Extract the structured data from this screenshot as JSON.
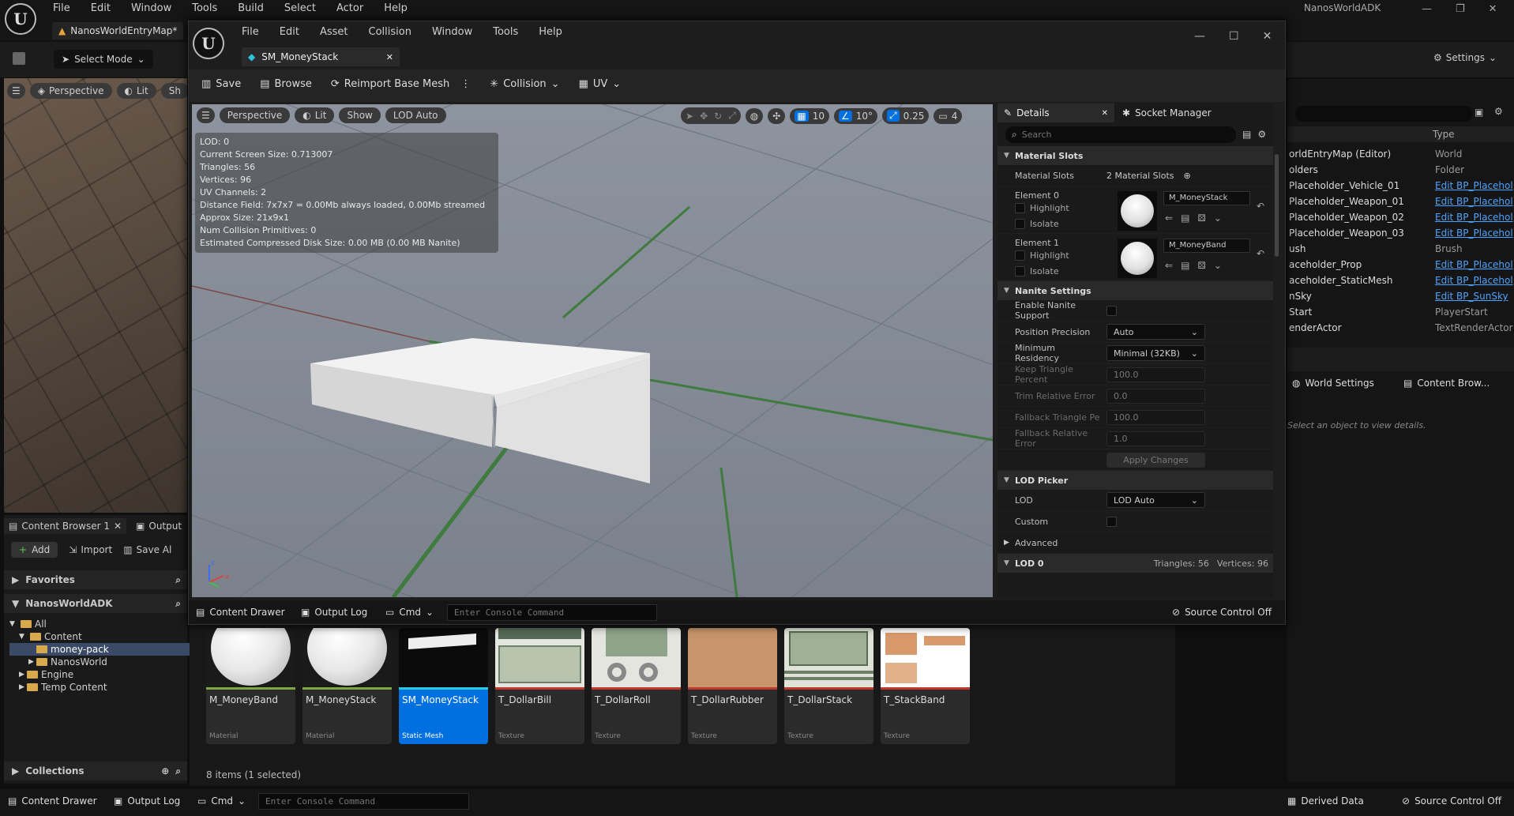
{
  "main_window": {
    "menu": [
      "File",
      "Edit",
      "Window",
      "Tools",
      "Build",
      "Select",
      "Actor",
      "Help"
    ],
    "project_name": "NanosWorldADK",
    "level_tab": "NanosWorldEntryMap*",
    "select_mode": "Select Mode",
    "settings": "Settings",
    "viewport": {
      "perspective": "Perspective",
      "lit": "Lit",
      "show": "Sh"
    },
    "outliner": {
      "type_header": "Type",
      "rows": [
        {
          "name": "orldEntryMap (Editor)",
          "type": "World",
          "link": false
        },
        {
          "name": "olders",
          "type": "Folder",
          "link": false
        },
        {
          "name": "Placeholder_Vehicle_01",
          "type": "Edit BP_Placehol",
          "link": true
        },
        {
          "name": "Placeholder_Weapon_01",
          "type": "Edit BP_Placehol",
          "link": true
        },
        {
          "name": "Placeholder_Weapon_02",
          "type": "Edit BP_Placehol",
          "link": true
        },
        {
          "name": "Placeholder_Weapon_03",
          "type": "Edit BP_Placehol",
          "link": true
        },
        {
          "name": "ush",
          "type": "Brush",
          "link": false
        },
        {
          "name": "aceholder_Prop",
          "type": "Edit BP_Placehol",
          "link": true
        },
        {
          "name": "aceholder_StaticMesh",
          "type": "Edit BP_Placehol",
          "link": true
        },
        {
          "name": "nSky",
          "type": "Edit BP_SunSky",
          "link": true
        },
        {
          "name": "Start",
          "type": "PlayerStart",
          "link": false
        },
        {
          "name": "enderActor",
          "type": "TextRenderActor",
          "link": false
        }
      ]
    },
    "world_settings_tab": "World Settings",
    "content_browser_tab": "Content Brow...",
    "select_hint": "Select an object to view details.",
    "content_browser": {
      "tab": "Content Browser 1",
      "output_tab": "Output",
      "add": "Add",
      "import": "Import",
      "save_all": "Save Al",
      "favorites": "Favorites",
      "project": "NanosWorldADK",
      "tree": [
        "All",
        "Content",
        "money-pack",
        "NanosWorld",
        "Engine",
        "Temp Content"
      ],
      "collections": "Collections",
      "status": "8 items (1 selected)"
    },
    "bottom_bar": {
      "content_drawer": "Content Drawer",
      "output_log": "Output Log",
      "cmd": "Cmd",
      "console_placeholder": "Enter Console Command",
      "derived_data": "Derived Data",
      "source_control": "Source Control Off"
    }
  },
  "mesh_editor": {
    "menu": [
      "File",
      "Edit",
      "Asset",
      "Collision",
      "Window",
      "Tools",
      "Help"
    ],
    "tab": "SM_MoneyStack",
    "toolbar": {
      "save": "Save",
      "browse": "Browse",
      "reimport": "Reimport Base Mesh",
      "collision": "Collision",
      "uv": "UV"
    },
    "viewport": {
      "perspective": "Perspective",
      "lit": "Lit",
      "show": "Show",
      "lod": "LOD Auto",
      "grid": "10",
      "angle": "10°",
      "scale": "0.25",
      "camera": "4",
      "stats": [
        "LOD:  0",
        "Current Screen Size:  0.713007",
        "Triangles:  56",
        "Vertices:  96",
        "UV Channels:  2",
        "Distance Field:  7x7x7 = 0.00Mb always loaded, 0.00Mb streamed",
        "Approx Size: 21x9x1",
        "Num Collision Primitives:  0",
        "Estimated Compressed Disk Size: 0.00 MB (0.00 MB Nanite)"
      ]
    },
    "details": {
      "tab": "Details",
      "socket_tab": "Socket Manager",
      "search_placeholder": "Search",
      "material_slots_header": "Material Slots",
      "material_slots_label": "Material Slots",
      "material_slots_count": "2 Material Slots",
      "elements": [
        {
          "label": "Element 0",
          "material": "M_MoneyStack"
        },
        {
          "label": "Element 1",
          "material": "M_MoneyBand"
        }
      ],
      "highlight": "Highlight",
      "isolate": "Isolate",
      "nanite_header": "Nanite Settings",
      "enable_nanite": "Enable Nanite Support",
      "position_precision": {
        "label": "Position Precision",
        "value": "Auto"
      },
      "min_residency": {
        "label": "Minimum Residency",
        "value": "Minimal (32KB)"
      },
      "keep_triangle": {
        "label": "Keep Triangle Percent",
        "value": "100.0"
      },
      "trim_error": {
        "label": "Trim Relative Error",
        "value": "0.0"
      },
      "fallback_triangle": {
        "label": "Fallback Triangle Perce",
        "value": "100.0"
      },
      "fallback_error": {
        "label": "Fallback Relative Error",
        "value": "1.0"
      },
      "apply": "Apply Changes",
      "lod_picker_header": "LOD Picker",
      "lod": {
        "label": "LOD",
        "value": "LOD Auto"
      },
      "custom": "Custom",
      "advanced": "Advanced",
      "lod0": {
        "label": "LOD 0",
        "triangles": "Triangles: 56",
        "vertices": "Vertices: 96"
      }
    },
    "bottom_bar": {
      "content_drawer": "Content Drawer",
      "output_log": "Output Log",
      "cmd": "Cmd",
      "console_placeholder": "Enter Console Command",
      "source_control": "Source Control Off"
    }
  },
  "assets": [
    {
      "name": "M_MoneyBand",
      "type": "Material",
      "color": "#7fa640",
      "thumb": "sphere"
    },
    {
      "name": "M_MoneyStack",
      "type": "Material",
      "color": "#7fa640",
      "thumb": "sphere"
    },
    {
      "name": "SM_MoneyStack",
      "type": "Static Mesh",
      "color": "#2bc7e0",
      "thumb": "mesh",
      "selected": true
    },
    {
      "name": "T_DollarBill",
      "type": "Texture",
      "color": "#c0392b",
      "thumb": "bill"
    },
    {
      "name": "T_DollarRoll",
      "type": "Texture",
      "color": "#c0392b",
      "thumb": "roll"
    },
    {
      "name": "T_DollarRubber",
      "type": "Texture",
      "color": "#c0392b",
      "thumb": "rubber"
    },
    {
      "name": "T_DollarStack",
      "type": "Texture",
      "color": "#c0392b",
      "thumb": "stack"
    },
    {
      "name": "T_StackBand",
      "type": "Texture",
      "color": "#c0392b",
      "thumb": "band"
    }
  ],
  "colors": {
    "accent": "#0070e0",
    "link": "#4ea3ff",
    "viewport_bg": "#8c939e"
  }
}
